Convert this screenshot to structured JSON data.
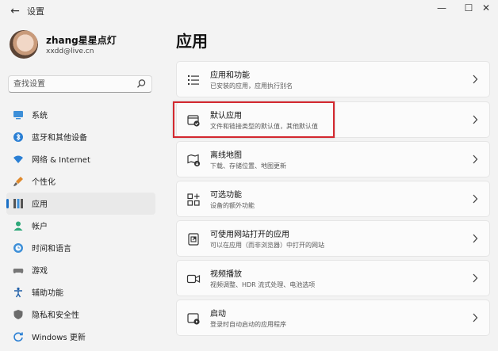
{
  "window": {
    "title": "设置",
    "back_icon": "back-arrow-icon",
    "controls": [
      "minimize-icon",
      "maximize-icon",
      "close-icon"
    ]
  },
  "user": {
    "name": "zhang星星点灯",
    "email": "xxdd@live.cn"
  },
  "search": {
    "placeholder": "查找设置",
    "icon": "search-icon"
  },
  "sidebar": {
    "items": [
      {
        "label": "系统",
        "icon": "monitor-icon",
        "active": false
      },
      {
        "label": "蓝牙和其他设备",
        "icon": "bluetooth-icon",
        "active": false
      },
      {
        "label": "网络 & Internet",
        "icon": "wifi-icon",
        "active": false
      },
      {
        "label": "个性化",
        "icon": "brush-icon",
        "active": false
      },
      {
        "label": "应用",
        "icon": "apps-icon",
        "active": true
      },
      {
        "label": "帐户",
        "icon": "person-icon",
        "active": false
      },
      {
        "label": "时间和语言",
        "icon": "globe-clock-icon",
        "active": false
      },
      {
        "label": "游戏",
        "icon": "gamepad-icon",
        "active": false
      },
      {
        "label": "辅助功能",
        "icon": "accessibility-icon",
        "active": false
      },
      {
        "label": "隐私和安全性",
        "icon": "shield-icon",
        "active": false
      },
      {
        "label": "Windows 更新",
        "icon": "update-icon",
        "active": false
      }
    ]
  },
  "main": {
    "title": "应用",
    "cards": [
      {
        "title": "应用和功能",
        "subtitle": "已安装的应用，应用执行别名",
        "icon": "list-icon"
      },
      {
        "title": "默认应用",
        "subtitle": "文件和链接类型的默认值，其他默认值",
        "icon": "default-apps-icon",
        "highlighted": true
      },
      {
        "title": "离线地图",
        "subtitle": "下载、存储位置、地图更新",
        "icon": "map-download-icon"
      },
      {
        "title": "可选功能",
        "subtitle": "设备的额外功能",
        "icon": "grid-plus-icon"
      },
      {
        "title": "可使用网站打开的应用",
        "subtitle": "可以在应用（而非浏览器）中打开的网站",
        "icon": "open-in-app-icon"
      },
      {
        "title": "视频播放",
        "subtitle": "视频调整、HDR 流式处理、电池选项",
        "icon": "video-icon"
      },
      {
        "title": "启动",
        "subtitle": "登录时自动启动的应用程序",
        "icon": "startup-icon"
      }
    ]
  },
  "colors": {
    "accent": "#1a6fc5",
    "highlight_border": "#d3282f",
    "background": "#f3f3f3",
    "card": "#fbfbfb"
  }
}
